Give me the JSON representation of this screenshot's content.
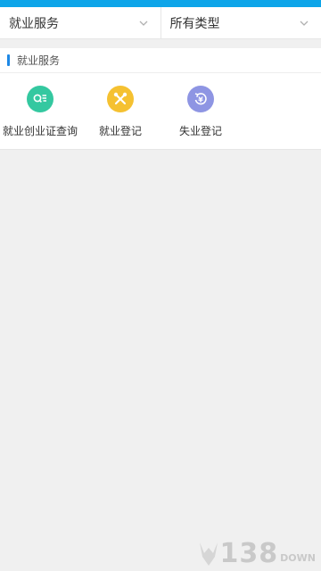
{
  "filters": {
    "service": "就业服务",
    "type": "所有类型"
  },
  "section": {
    "title": "就业服务"
  },
  "services": [
    {
      "label": "就业创业证查询",
      "icon": "search-list-icon",
      "color": "#34c8a0"
    },
    {
      "label": "就业登记",
      "icon": "tools-icon",
      "color": "#f5c131"
    },
    {
      "label": "失业登记",
      "icon": "yen-refresh-icon",
      "color": "#8e95e3"
    }
  ],
  "watermark": {
    "number": "138",
    "suffix": "DOWN"
  },
  "colors": {
    "status_bar": "#0ea5e9",
    "section_marker": "#1e88e5"
  }
}
